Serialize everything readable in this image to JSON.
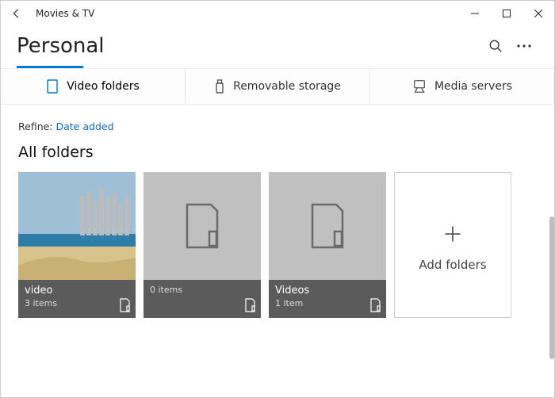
{
  "titlebar": {
    "app_name": "Movies & TV"
  },
  "header": {
    "page_title": "Personal"
  },
  "tabs": [
    {
      "label": "Video folders",
      "icon": "folder-icon",
      "active": true
    },
    {
      "label": "Removable storage",
      "icon": "usb-icon",
      "active": false
    },
    {
      "label": "Media servers",
      "icon": "server-icon",
      "active": false
    }
  ],
  "refine": {
    "label": "Refine:",
    "value": "Date added"
  },
  "section": {
    "title": "All folders"
  },
  "folders": [
    {
      "name": "video",
      "count": "3 items",
      "thumb": "beach"
    },
    {
      "name": "",
      "count": "0 items",
      "thumb": "placeholder"
    },
    {
      "name": "Videos",
      "count": "1 item",
      "thumb": "placeholder"
    }
  ],
  "add": {
    "label": "Add folders"
  }
}
